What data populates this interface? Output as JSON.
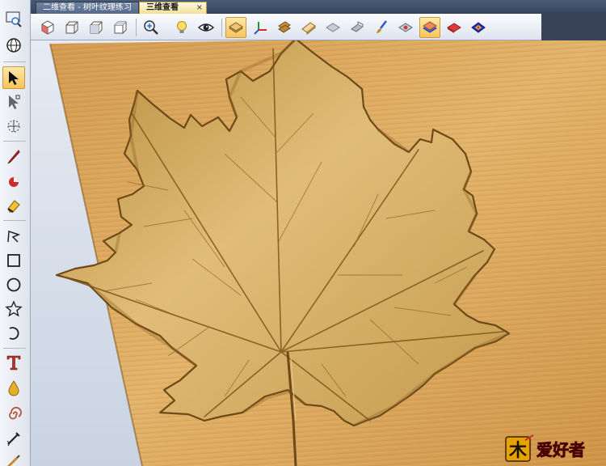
{
  "tabs": [
    {
      "label": "二维查看 - 树叶纹理练习",
      "active": false
    },
    {
      "label": "三维查看",
      "active": true
    }
  ],
  "tab_close_glyph": "×",
  "watermark": {
    "logo_glyph": "木",
    "text": "爱好者"
  },
  "icons": {
    "top_toolbar": [
      "iso-view-icon",
      "front-view-icon",
      "side-view-icon",
      "top-view-icon",
      "zoom-icon",
      "bulb-icon",
      "eye-icon",
      "layer-plane-icon",
      "axis-icon",
      "relief-stack-icon",
      "relief-slab-icon",
      "relief-flat-icon",
      "relief-shade-icon",
      "paint-brush-icon",
      "texture-diamond-icon",
      "color-stack-icon",
      "red-relief-icon",
      "gradient-diamond-icon"
    ],
    "left_toolbar": [
      "zoom-window-icon",
      "globe-icon",
      "select-arrow-icon",
      "node-edit-icon",
      "transform-icon",
      "pen-icon",
      "paint-bucket-icon",
      "eraser-icon",
      "polyline-icon",
      "rectangle-icon",
      "circle-icon",
      "star-icon",
      "arc-icon",
      "text-icon",
      "drop-icon",
      "spiral-icon",
      "sculpt-icon",
      "smooth-icon"
    ]
  },
  "colors": {
    "wood": "#d9a559",
    "wood_dark": "#b27d35",
    "accent_active": "#f7c45b",
    "chrome_dark": "#34435a"
  }
}
